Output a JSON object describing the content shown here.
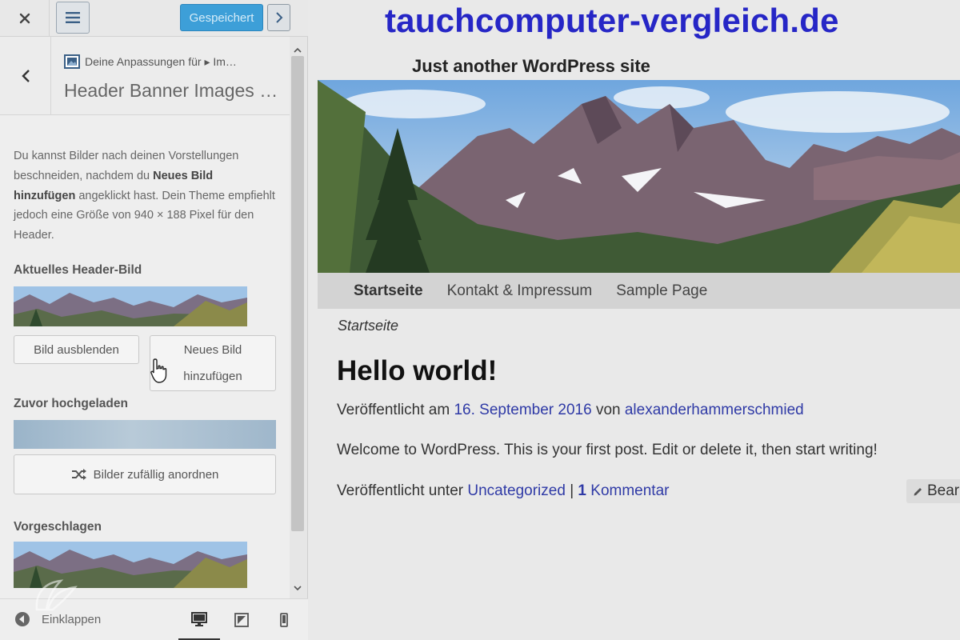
{
  "topbar": {
    "saved_label": "Gespeichert",
    "close_icon": "close-icon",
    "menu_icon": "menu-icon",
    "next_icon": "chevron-right-icon"
  },
  "panel": {
    "breadcrumb": "Deine Anpassungen für ▸ Im…",
    "title": "Header Banner Images …",
    "description_part1": "Du kannst Bilder nach deinen Vorstellungen beschneiden, nachdem du ",
    "description_bold": "Neues Bild hinzufügen",
    "description_part2": " angeklickt hast. Dein Theme empfiehlt jedoch eine Größe von 940 × 188 Pixel für den Header.",
    "current_header_label": "Aktuelles Header-Bild",
    "hide_image_label": "Bild ausblenden",
    "add_new_label_line1": "Neues Bild",
    "add_new_label_line2": "hinzufügen",
    "previously_uploaded_label": "Zuvor hochgeladen",
    "shuffle_label": "Bilder zufällig anordnen",
    "suggested_label": "Vorgeschlagen"
  },
  "footer": {
    "collapse_label": "Einklappen",
    "devices": [
      "desktop",
      "tablet",
      "mobile"
    ],
    "active_device": "desktop"
  },
  "site": {
    "title": "tauchcomputer-vergleich.de",
    "tagline": "Just another WordPress site",
    "nav": [
      "Startseite",
      "Kontakt & Impressum",
      "Sample Page"
    ],
    "current_nav": "Startseite",
    "breadcrumb": "Startseite",
    "post": {
      "title": "Hello world!",
      "published_prefix": "Veröffentlicht am",
      "date": "16. September 2016",
      "by": "von",
      "author": "alexanderhammerschmied",
      "content": "Welcome to WordPress. This is your first post. Edit or delete it, then start writing!",
      "category_prefix": "Veröffentlicht unter",
      "category": "Uncategorized",
      "separator": "|",
      "comment_count": "1",
      "comment_label": "Kommentar",
      "edit_label": "Bear"
    }
  },
  "colors": {
    "saved_button": "#3d9fd8",
    "site_title": "#2626c6",
    "link": "#2f3aa6"
  }
}
